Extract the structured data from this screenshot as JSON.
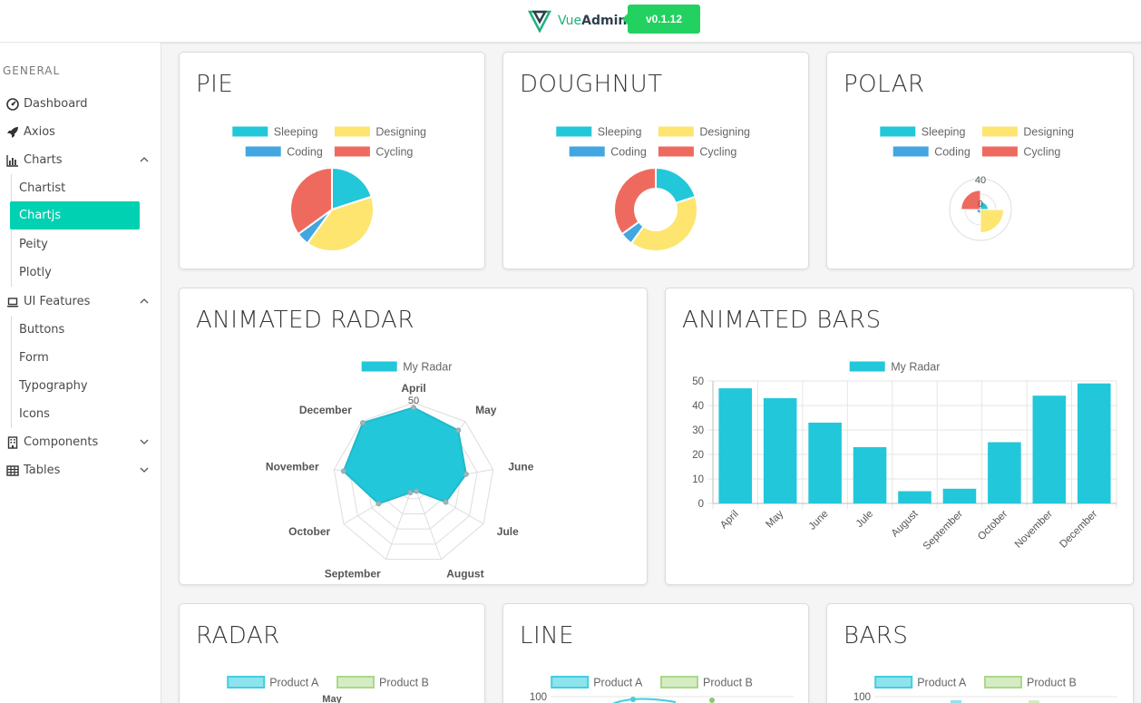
{
  "header": {
    "brand_vue": "Vue",
    "brand_admin": "Admin",
    "version": "v0.1.12"
  },
  "sidebar": {
    "label": "GENERAL",
    "items": [
      {
        "label": "Dashboard",
        "icon": "dashboard-icon"
      },
      {
        "label": "Axios",
        "icon": "rocket-icon"
      },
      {
        "label": "Charts",
        "icon": "bar-chart-icon",
        "expanded": true
      },
      {
        "label": "UI Features",
        "icon": "laptop-icon",
        "expanded": true
      },
      {
        "label": "Components",
        "icon": "building-icon",
        "expanded": false
      },
      {
        "label": "Tables",
        "icon": "table-icon",
        "expanded": false
      }
    ],
    "charts_sub": [
      {
        "label": "Chartist"
      },
      {
        "label": "Chartjs",
        "active": true
      },
      {
        "label": "Peity"
      },
      {
        "label": "Plotly"
      }
    ],
    "ui_sub": [
      {
        "label": "Buttons"
      },
      {
        "label": "Form"
      },
      {
        "label": "Typography"
      },
      {
        "label": "Icons"
      }
    ]
  },
  "cards": {
    "pie": "PIE",
    "doughnut": "DOUGHNUT",
    "polar": "POLAR",
    "animated_radar": "ANIMATED RADAR",
    "animated_bars": "ANIMATED BARS",
    "radar": "RADAR",
    "line": "LINE",
    "bars": "BARS"
  },
  "colors": {
    "accent": "#00d1b2",
    "version_badge": "#23d160",
    "cyan": "#22c7da",
    "yellow": "#fde570",
    "blue": "#42a6e0",
    "red": "#ef6a5e",
    "green_light": "#c7e3b0"
  },
  "chart_data": [
    {
      "type": "pie",
      "legend": [
        "Sleeping",
        "Designing",
        "Coding",
        "Cycling"
      ],
      "values": [
        20,
        40,
        5,
        35
      ],
      "colors": [
        "#22c7da",
        "#fde570",
        "#42a6e0",
        "#ef6a5e"
      ]
    },
    {
      "type": "doughnut",
      "legend": [
        "Sleeping",
        "Designing",
        "Coding",
        "Cycling"
      ],
      "values": [
        20,
        40,
        5,
        35
      ],
      "colors": [
        "#22c7da",
        "#fde570",
        "#42a6e0",
        "#ef6a5e"
      ]
    },
    {
      "type": "polar",
      "legend": [
        "Sleeping",
        "Designing",
        "Coding",
        "Cycling"
      ],
      "values": [
        10,
        30,
        5,
        25
      ],
      "rmax": 40,
      "tick_labels": [
        "40",
        "0"
      ],
      "colors": [
        "#22c7da",
        "#fde570",
        "#42a6e0",
        "#ef6a5e"
      ]
    },
    {
      "type": "radar",
      "series": [
        {
          "name": "My Radar",
          "values": [
            47,
            43,
            33,
            23,
            5,
            6,
            25,
            44,
            49
          ]
        }
      ],
      "categories": [
        "April",
        "May",
        "June",
        "Jule",
        "August",
        "September",
        "October",
        "November",
        "December"
      ],
      "rmax": 50,
      "tick_label": "50"
    },
    {
      "type": "bar",
      "series": [
        {
          "name": "My Radar",
          "values": [
            47,
            43,
            33,
            23,
            5,
            6,
            25,
            44,
            49
          ]
        }
      ],
      "categories": [
        "April",
        "May",
        "June",
        "Jule",
        "August",
        "September",
        "October",
        "November",
        "December"
      ],
      "yticks": [
        "0",
        "10",
        "20",
        "30",
        "40",
        "50"
      ],
      "ylim": [
        0,
        50
      ]
    },
    {
      "type": "radar",
      "series": [
        {
          "name": "Product A"
        },
        {
          "name": "Product B"
        }
      ],
      "categories": [
        "May"
      ]
    },
    {
      "type": "line",
      "series": [
        {
          "name": "Product A"
        },
        {
          "name": "Product B"
        }
      ],
      "yticks": [
        "100"
      ]
    },
    {
      "type": "bar",
      "series": [
        {
          "name": "Product A"
        },
        {
          "name": "Product B"
        }
      ],
      "yticks": [
        "100"
      ]
    }
  ]
}
